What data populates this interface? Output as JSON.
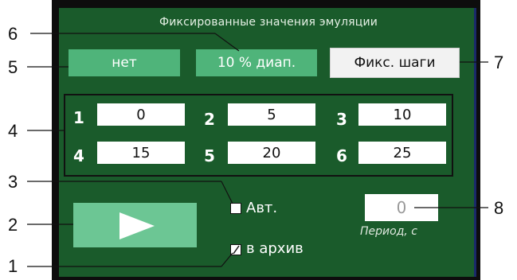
{
  "panel": {
    "title": "Фиксированные значения эмуляции"
  },
  "mode_buttons": {
    "none": "нет",
    "range": "10 % диап.",
    "fixed_steps": "Фикс. шаги"
  },
  "steps": [
    {
      "index": "1",
      "value": "0"
    },
    {
      "index": "2",
      "value": "5"
    },
    {
      "index": "3",
      "value": "10"
    },
    {
      "index": "4",
      "value": "15"
    },
    {
      "index": "5",
      "value": "20"
    },
    {
      "index": "6",
      "value": "25"
    }
  ],
  "auto": {
    "label": "Авт.",
    "checked": false
  },
  "archive": {
    "label": "в архив",
    "checked": true
  },
  "period": {
    "value": "0",
    "label": "Период, с"
  },
  "callouts": [
    "1",
    "2",
    "3",
    "4",
    "5",
    "6",
    "7",
    "8"
  ],
  "colors": {
    "panel": "#1a5b2b",
    "button": "#4fb47a",
    "play": "#6cc694"
  }
}
